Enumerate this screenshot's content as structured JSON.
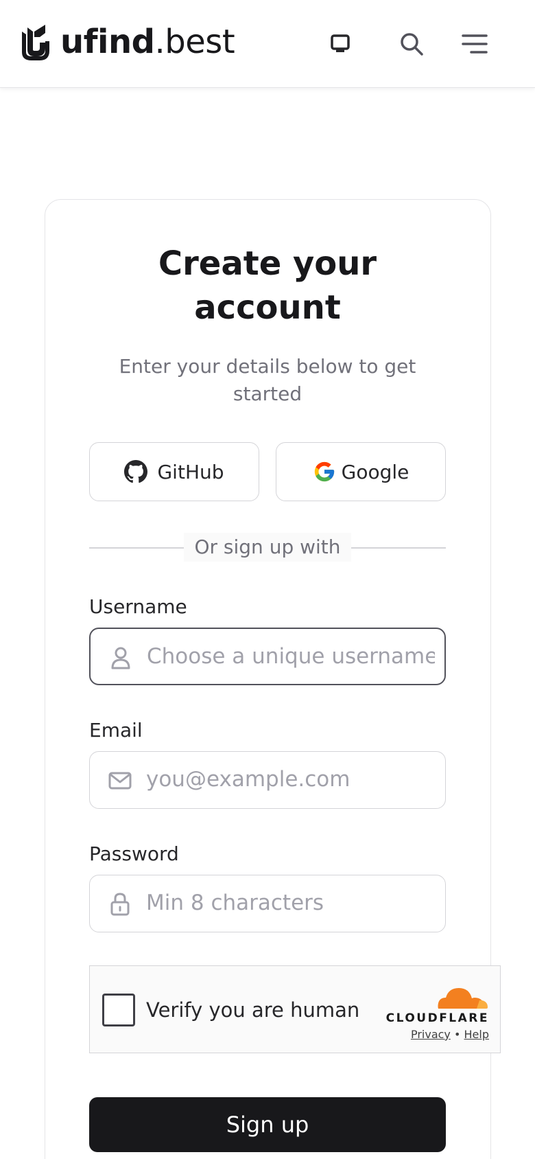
{
  "header": {
    "logo_bold": "ufind",
    "logo_light": ".best",
    "icons": [
      "monitor-icon",
      "search-icon",
      "menu-icon"
    ]
  },
  "card": {
    "title_line1": "Create your",
    "title_line2": "account",
    "subtitle": "Enter your details below to get started",
    "github_label": "GitHub",
    "google_label": "Google",
    "divider_text": "Or sign up with",
    "username_label": "Username",
    "username_placeholder": "Choose a unique username",
    "email_label": "Email",
    "email_placeholder": "you@example.com",
    "password_label": "Password",
    "password_placeholder": "Min 8 characters",
    "signup_label": "Sign up"
  },
  "turnstile": {
    "label": "Verify you are human",
    "brand": "CLOUDFLARE",
    "privacy": "Privacy",
    "separator": "•",
    "help": "Help"
  },
  "colors": {
    "primary_button": "#18181b",
    "muted_text": "#71717a",
    "border": "#d4d4d8",
    "cloudflare_orange": "#f38020"
  }
}
